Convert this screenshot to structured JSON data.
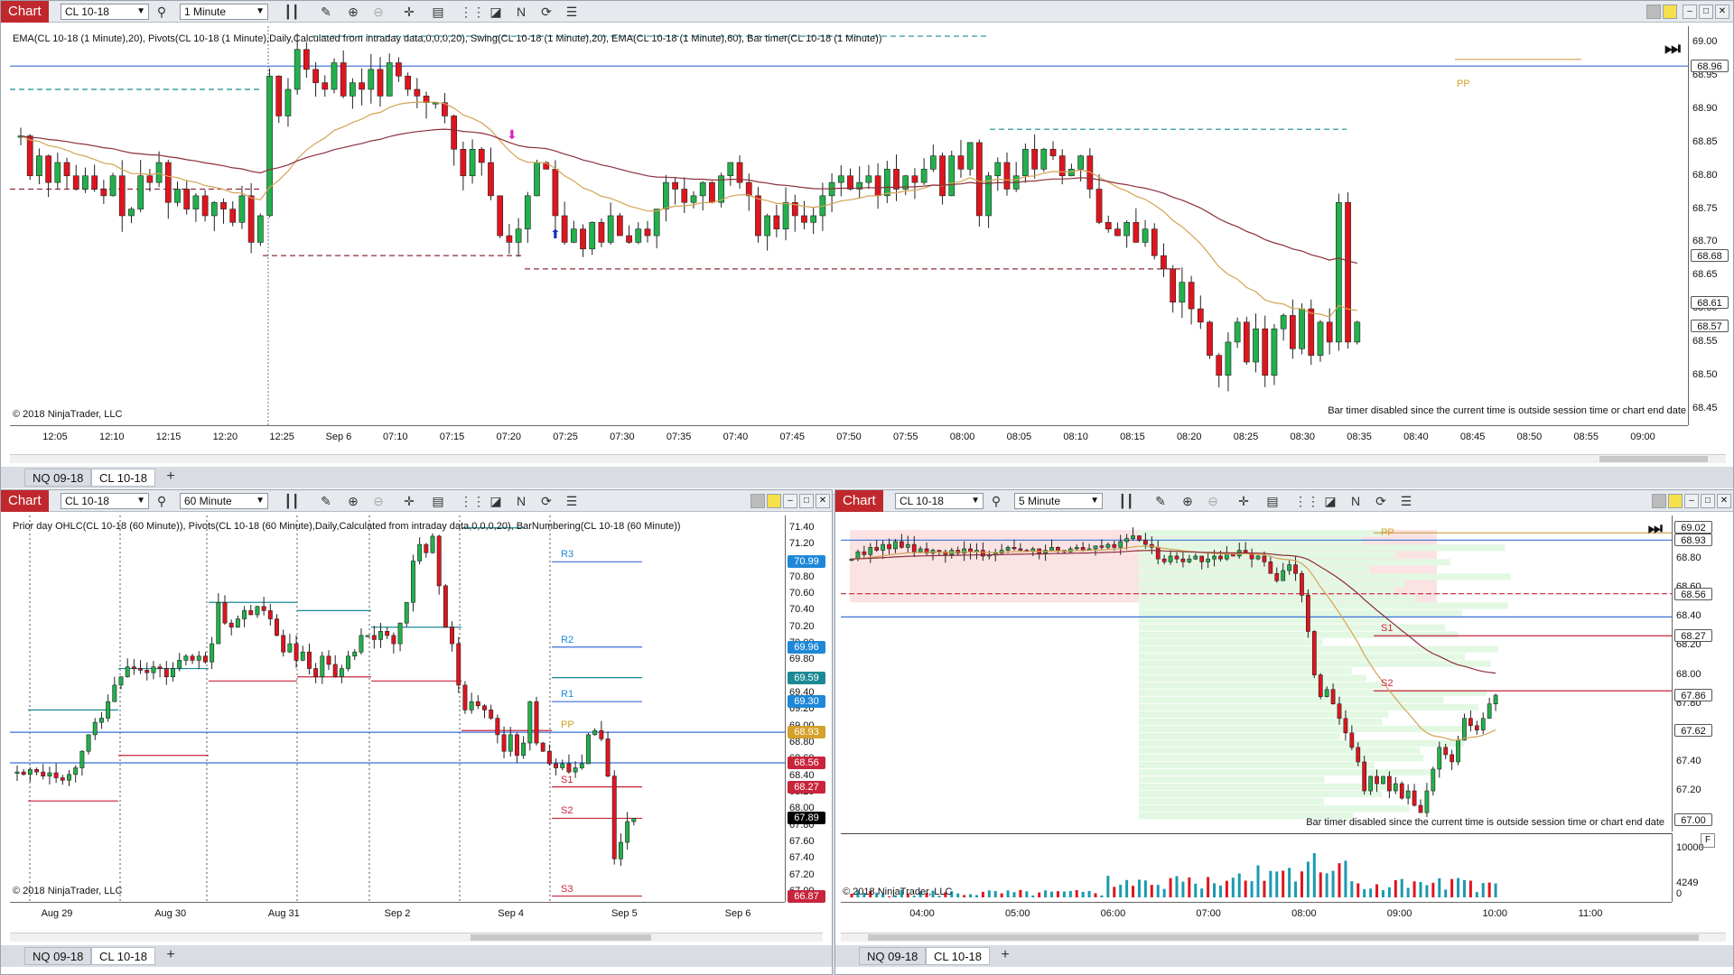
{
  "top_window": {
    "badge": "Chart",
    "instrument": "CL 10-18",
    "interval": "1 Minute",
    "indicators": "EMA(CL 10-18 (1 Minute),20), Pivots(CL 10-18 (1 Minute),Daily,Calculated from intraday data,0,0,0,20), Swing(CL 10-18 (1 Minute),20), EMA(CL 10-18 (1 Minute),60), Bar timer(CL 10-18 (1 Minute))",
    "copyright": "© 2018 NinjaTrader, LLC",
    "bar_timer_msg": "Bar timer disabled since the current time is outside session time or chart end date",
    "pivot_label": "PP",
    "y_ticks": [
      "69.00",
      "68.95",
      "68.90",
      "68.85",
      "68.80",
      "68.75",
      "68.70",
      "68.65",
      "68.60",
      "68.55",
      "68.50",
      "68.45"
    ],
    "y_tags": [
      {
        "label": "68.96",
        "price": 68.965,
        "color": "#ffffff",
        "text": "#111"
      },
      {
        "label": "68.68",
        "price": 68.68,
        "color": "#ffffff",
        "text": "#111"
      },
      {
        "label": "68.61",
        "price": 68.61,
        "color": "#ffffff",
        "text": "#111"
      },
      {
        "label": "68.57",
        "price": 68.575,
        "color": "#ffffff",
        "text": "#111"
      }
    ],
    "x_ticks": [
      "12:05",
      "12:10",
      "12:15",
      "12:20",
      "12:25",
      "Sep 6",
      "07:10",
      "07:15",
      "07:20",
      "07:25",
      "07:30",
      "07:35",
      "07:40",
      "07:45",
      "07:50",
      "07:55",
      "08:00",
      "08:05",
      "08:10",
      "08:15",
      "08:20",
      "08:25",
      "08:30",
      "08:35",
      "08:40",
      "08:45",
      "08:50",
      "08:55",
      "09:00"
    ],
    "tabs": [
      "NQ 09-18",
      "CL 10-18"
    ],
    "active_tab": 1
  },
  "bottom_left_window": {
    "badge": "Chart",
    "instrument": "CL 10-18",
    "interval": "60 Minute",
    "indicators": "Prior day OHLC(CL 10-18 (60 Minute)), Pivots(CL 10-18 (60 Minute),Daily,Calculated from intraday data,0,0,0,20), BarNumbering(CL 10-18 (60 Minute))",
    "copyright": "© 2018 NinjaTrader, LLC",
    "y_ticks": [
      "71.40",
      "71.20",
      "71.00",
      "70.80",
      "70.60",
      "70.40",
      "70.20",
      "70.00",
      "69.80",
      "69.60",
      "69.40",
      "69.20",
      "69.00",
      "68.80",
      "68.60",
      "68.40",
      "68.20",
      "68.00",
      "67.80",
      "67.60",
      "67.40",
      "67.20",
      "67.00"
    ],
    "y_tags": [
      {
        "label": "70.99",
        "price": 70.99,
        "color": "#1e88d8",
        "text": "#fff"
      },
      {
        "label": "69.96",
        "price": 69.96,
        "color": "#1e88d8",
        "text": "#fff"
      },
      {
        "label": "69.59",
        "price": 69.59,
        "color": "#1a8a94",
        "text": "#fff"
      },
      {
        "label": "69.30",
        "price": 69.3,
        "color": "#1e88d8",
        "text": "#fff"
      },
      {
        "label": "68.93",
        "price": 68.93,
        "color": "#d4a12a",
        "text": "#fff"
      },
      {
        "label": "68.56",
        "price": 68.56,
        "color": "#c8243c",
        "text": "#fff"
      },
      {
        "label": "68.27",
        "price": 68.27,
        "color": "#c8243c",
        "text": "#fff"
      },
      {
        "label": "67.89",
        "price": 67.89,
        "color": "#000000",
        "text": "#fff"
      },
      {
        "label": "66.87",
        "price": 66.95,
        "color": "#c8243c",
        "text": "#fff"
      }
    ],
    "pivot_labels": [
      {
        "label": "R3",
        "price": 70.99,
        "color": "#1e88d8"
      },
      {
        "label": "R2",
        "price": 69.96,
        "color": "#1e88d8"
      },
      {
        "label": "R1",
        "price": 69.3,
        "color": "#1e88d8"
      },
      {
        "label": "PP",
        "price": 68.93,
        "color": "#d4a12a"
      },
      {
        "label": "S1",
        "price": 68.27,
        "color": "#c8243c"
      },
      {
        "label": "S2",
        "price": 67.89,
        "color": "#c8243c"
      },
      {
        "label": "S3",
        "price": 66.95,
        "color": "#c8243c"
      }
    ],
    "x_ticks": [
      "Aug 29",
      "Aug 30",
      "Aug 31",
      "Sep 2",
      "Sep 4",
      "Sep 5",
      "Sep 6"
    ],
    "tabs": [
      "NQ 09-18",
      "CL 10-18"
    ],
    "active_tab": 1
  },
  "bottom_right_window": {
    "badge": "Chart",
    "instrument": "CL 10-18",
    "interval": "5 Minute",
    "copyright": "© 2018 NinjaTrader, LLC",
    "bar_timer_msg": "Bar timer disabled since the current time is outside session time or chart end date",
    "y_ticks": [
      "69.00",
      "68.80",
      "68.60",
      "68.40",
      "68.20",
      "68.00",
      "67.80",
      "67.60",
      "67.40",
      "67.20",
      "67.00"
    ],
    "y_tags": [
      {
        "label": "69.02",
        "price": 69.02,
        "color": "#ffffff",
        "text": "#111"
      },
      {
        "label": "68.93",
        "price": 68.93,
        "color": "#ffffff",
        "text": "#111"
      },
      {
        "label": "68.56",
        "price": 68.56,
        "color": "#ffffff",
        "text": "#111"
      },
      {
        "label": "68.27",
        "price": 68.27,
        "color": "#ffffff",
        "text": "#111"
      },
      {
        "label": "67.86",
        "price": 67.86,
        "color": "#ffffff",
        "text": "#111"
      },
      {
        "label": "67.62",
        "price": 67.62,
        "color": "#ffffff",
        "text": "#111"
      },
      {
        "label": "67.00",
        "price": 67.0,
        "color": "#ffffff",
        "text": "#111"
      }
    ],
    "pivot_labels": [
      {
        "label": "PP",
        "price": 68.93,
        "color": "#d4a12a"
      },
      {
        "label": "S1",
        "price": 68.27,
        "color": "#c8243c"
      },
      {
        "label": "S2",
        "price": 67.89,
        "color": "#c8243c"
      }
    ],
    "volume_ticks": [
      "10000",
      "4249",
      "0"
    ],
    "x_ticks": [
      "04:00",
      "05:00",
      "06:00",
      "07:00",
      "08:00",
      "09:00",
      "10:00",
      "11:00"
    ],
    "tabs": [
      "NQ 09-18",
      "CL 10-18"
    ],
    "active_tab": 1
  },
  "colors": {
    "up": "#22b14c",
    "down": "#e0141e",
    "ema_fast": "#d4a354",
    "ema_slow": "#8b2e3a",
    "pivot_blue": "#3a6fd8",
    "pivot_teal": "#1a8a94",
    "pivot_red": "#c8243c"
  }
}
